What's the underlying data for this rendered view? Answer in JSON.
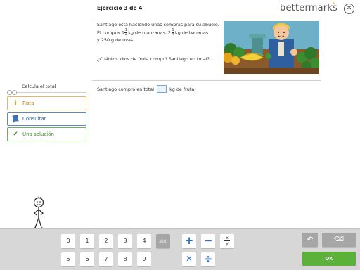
{
  "header": {
    "title": "Ejercicio 3 de 4",
    "brand": "bettermarks",
    "close_glyph": "✕"
  },
  "sidebar": {
    "step_label": "Calcula el total",
    "buttons": [
      {
        "label": "Pista",
        "icon": "info-icon",
        "glyph": "i",
        "color": "#e09a1a"
      },
      {
        "label": "Consultar",
        "icon": "book-icon",
        "color": "#2d5f9e"
      },
      {
        "label": "Una solución",
        "icon": "checkmark-icon",
        "glyph": "✔",
        "color": "#3e8a2a"
      }
    ]
  },
  "problem": {
    "line1": "Santiago está haciendo unas compras para su abuelo.",
    "line2_a": "Él compra 3",
    "frac1_num": "1",
    "frac1_den": "2",
    "line2_b": "kg de manzanas, 2",
    "frac2_num": "1",
    "frac2_den": "4",
    "line2_c": "kg de bananas",
    "line3": "y 250 g de uvas.",
    "question": "¿Cuántos kilos de fruta compró Santiago en total?"
  },
  "answer": {
    "prefix": "Santiago compró en total",
    "suffix": "kg de fruta.",
    "value": ""
  },
  "keypad": {
    "row1": [
      "0",
      "1",
      "2",
      "3",
      "4"
    ],
    "row2": [
      "5",
      "6",
      "7",
      "8",
      "9"
    ],
    "abc": "abc",
    "plus": "+",
    "minus": "−",
    "times": "✕",
    "divide": "÷",
    "frac_top": "x",
    "frac_bottom": "y",
    "undo_glyph": "↶",
    "backspace_glyph": "⌫",
    "ok": "OK"
  },
  "colors": {
    "accent_blue": "#2f6fc2",
    "ok_green": "#5bb13a",
    "hint_orange": "#e09a1a"
  }
}
